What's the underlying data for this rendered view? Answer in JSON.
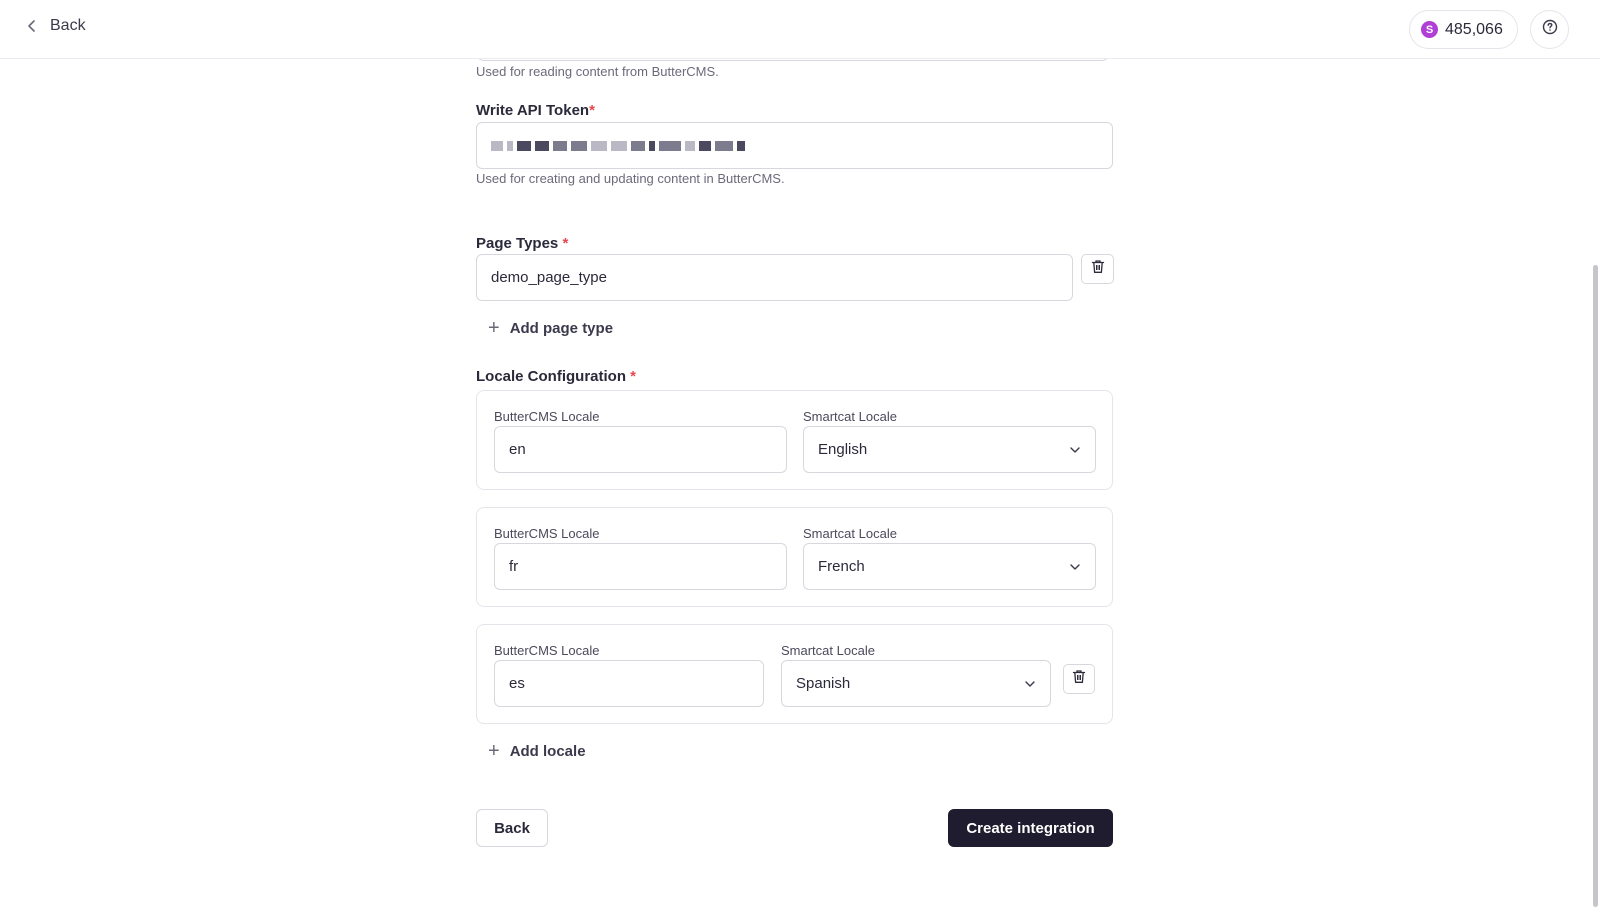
{
  "header": {
    "back_label": "Back",
    "credits_value": "485,066",
    "credits_coin_letter": "S"
  },
  "read_token": {
    "help": "Used for reading content from ButterCMS."
  },
  "write_token": {
    "label": "Write API Token",
    "required_mark": "*",
    "help": "Used for creating and updating content in ButterCMS."
  },
  "page_types": {
    "label": "Page Types",
    "required_mark": "*",
    "items": [
      "demo_page_type"
    ],
    "add_label": "Add page type"
  },
  "locale_config": {
    "label": "Locale Configuration",
    "required_mark": "*",
    "butter_label": "ButterCMS Locale",
    "smartcat_label": "Smartcat Locale",
    "rows": [
      {
        "butter": "en",
        "smartcat": "English"
      },
      {
        "butter": "fr",
        "smartcat": "French"
      },
      {
        "butter": "es",
        "smartcat": "Spanish"
      }
    ],
    "add_label": "Add locale"
  },
  "footer": {
    "back_label": "Back",
    "create_label": "Create integration"
  },
  "colors": {
    "primary": "#1e1c2e",
    "required": "#e5484d",
    "coin": "#b03fd6"
  }
}
